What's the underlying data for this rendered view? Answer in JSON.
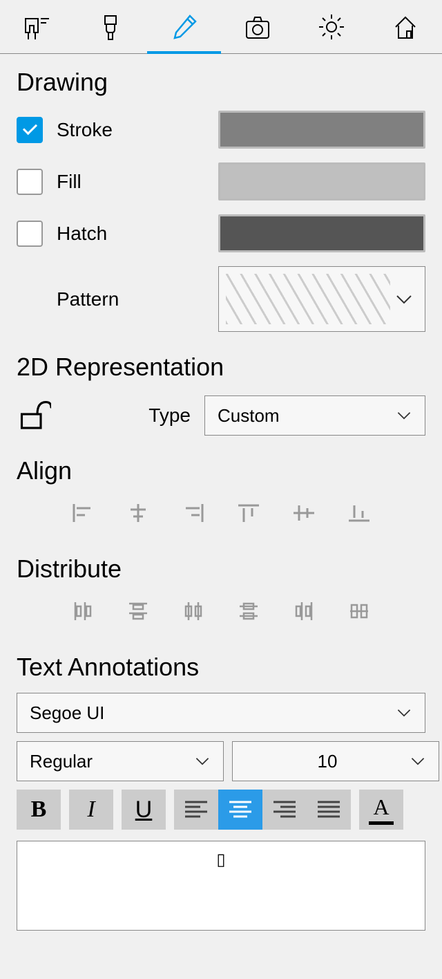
{
  "sections": {
    "drawing": "Drawing",
    "rep2d": "2D Representation",
    "align": "Align",
    "distribute": "Distribute",
    "text": "Text Annotations"
  },
  "drawing": {
    "stroke_label": "Stroke",
    "stroke_checked": true,
    "stroke_color": "#808080",
    "fill_label": "Fill",
    "fill_checked": false,
    "fill_color": "#bfbfbf",
    "hatch_label": "Hatch",
    "hatch_checked": false,
    "hatch_color": "#555555",
    "pattern_label": "Pattern"
  },
  "rep2d": {
    "type_label": "Type",
    "type_value": "Custom"
  },
  "text_annotations": {
    "font": "Segoe UI",
    "weight": "Regular",
    "size": "10",
    "content": "▯"
  }
}
